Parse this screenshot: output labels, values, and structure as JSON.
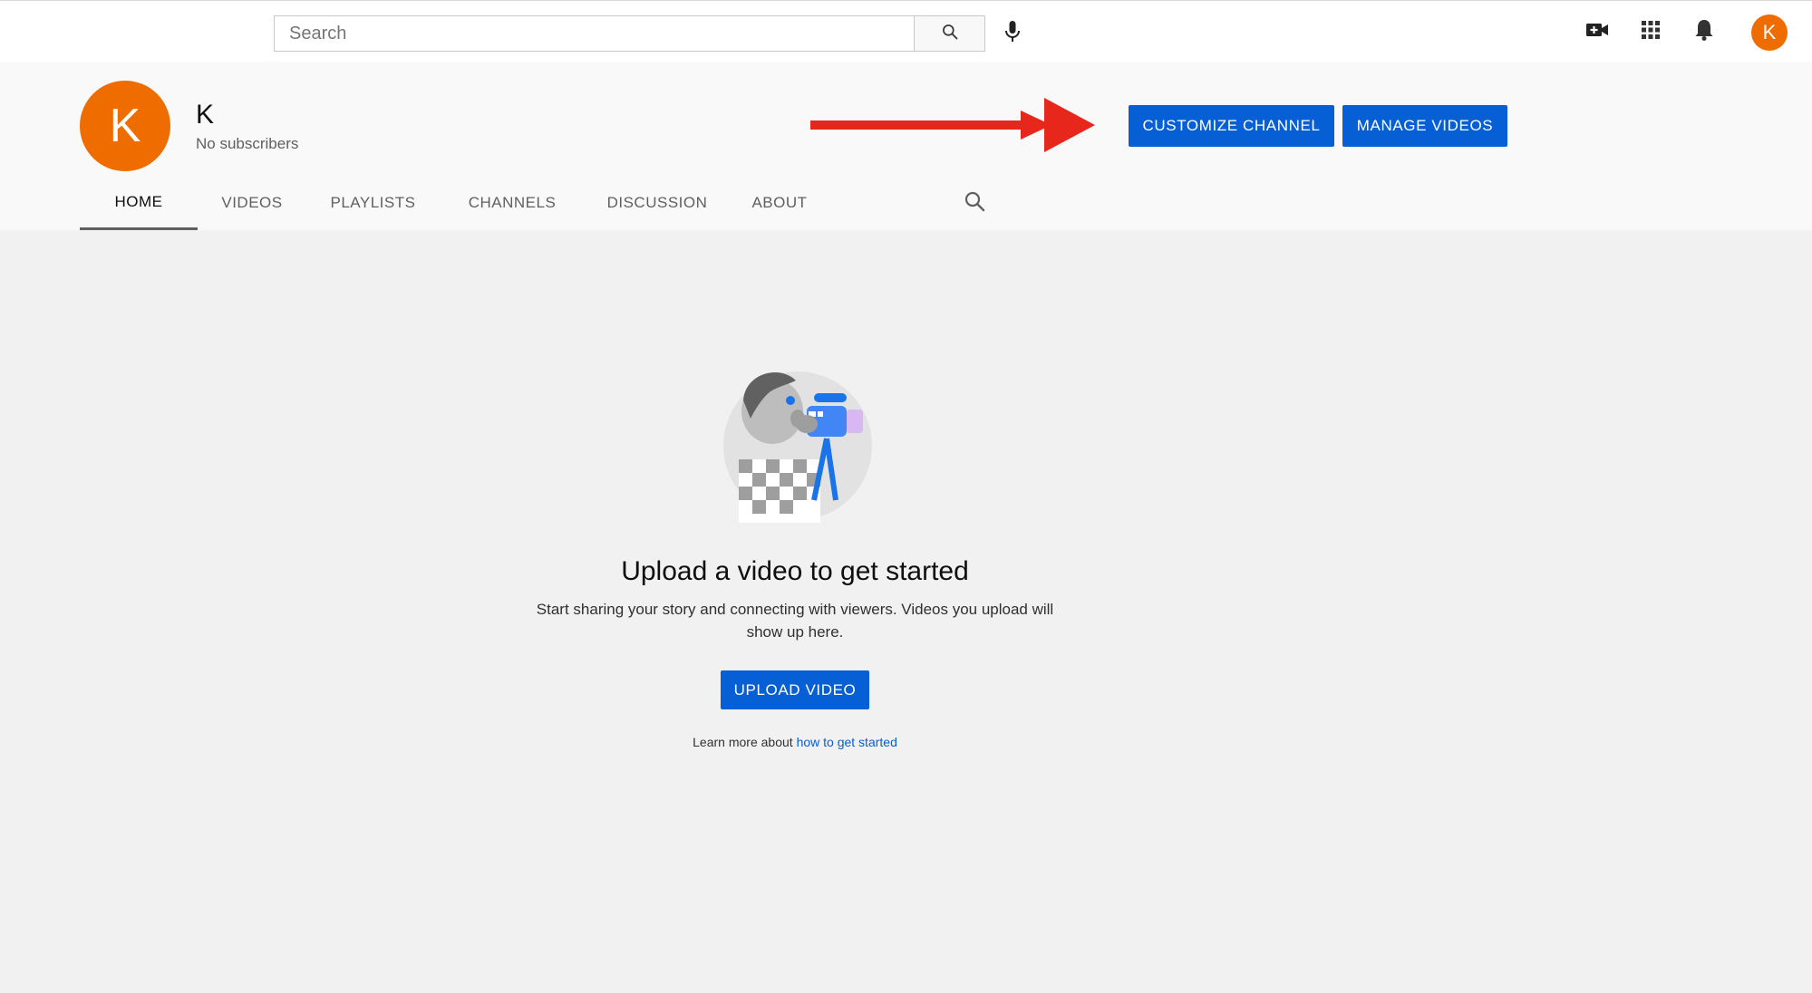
{
  "search": {
    "placeholder": "Search"
  },
  "icons": {
    "search": "search-icon",
    "mic": "mic-icon",
    "create": "video-camera-plus-icon",
    "apps": "apps-grid-icon",
    "notifications": "bell-icon",
    "tab_search": "search-icon"
  },
  "header": {
    "avatar_initial": "K"
  },
  "channel": {
    "avatar_initial": "K",
    "name": "K",
    "subscribers": "No subscribers",
    "customize_label": "CUSTOMIZE CHANNEL",
    "manage_label": "MANAGE VIDEOS"
  },
  "tabs": [
    {
      "label": "HOME",
      "active": true
    },
    {
      "label": "VIDEOS"
    },
    {
      "label": "PLAYLISTS"
    },
    {
      "label": "CHANNELS"
    },
    {
      "label": "DISCUSSION"
    },
    {
      "label": "ABOUT"
    }
  ],
  "empty_state": {
    "title": "Upload a video to get started",
    "description": "Start sharing your story and connecting with viewers. Videos you upload will show up here.",
    "upload_label": "UPLOAD VIDEO",
    "learn_prefix": "Learn more about",
    "learn_link": "how to get started"
  },
  "colors": {
    "accent_blue": "#065fd4",
    "avatar_orange": "#ef6c00",
    "arrow_red": "#e8271c",
    "page_bg": "#f1f1f1",
    "header_bg": "#f9f9f9"
  }
}
